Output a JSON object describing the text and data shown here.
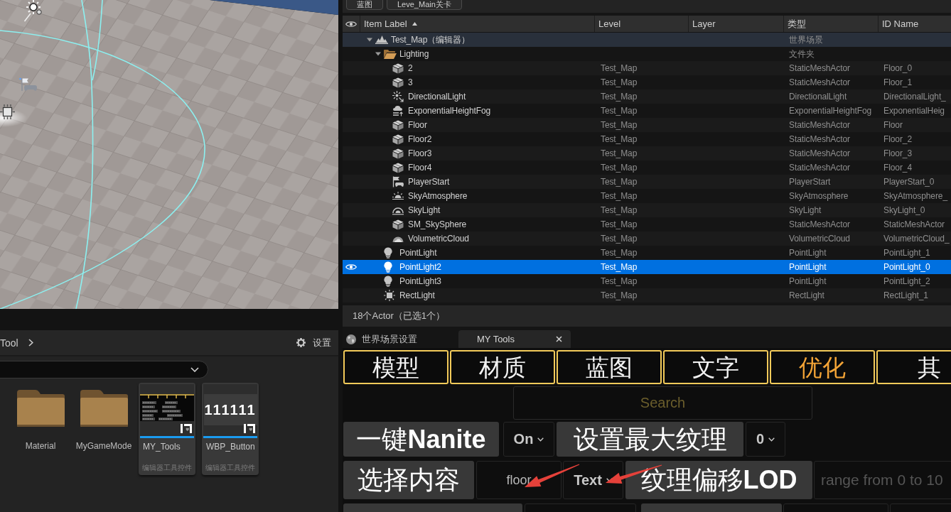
{
  "level_tabs": [
    {
      "label": "蓝图"
    },
    {
      "label": "Leve_Main关卡"
    }
  ],
  "outliner": {
    "columns": [
      {
        "label": "Item Label",
        "sorted": true
      },
      {
        "label": "Level",
        "sorted": false
      },
      {
        "label": "Layer",
        "sorted": false
      },
      {
        "label": "类型",
        "sorted": false
      },
      {
        "label": "ID Name",
        "sorted": false
      }
    ],
    "rows": [
      {
        "kind": "world",
        "label": "Test_Map（编辑器）",
        "type": "世界场景",
        "expanded": true,
        "selected": false,
        "children": [
          {
            "kind": "folder",
            "label": "Lighting",
            "type": "文件夹",
            "expanded": true,
            "selected": false,
            "children": [
              {
                "kind": "mesh",
                "label": "2",
                "level": "Test_Map",
                "type": "StaticMeshActor",
                "id_name": "Floor_0",
                "selected": false
              },
              {
                "kind": "mesh",
                "label": "3",
                "level": "Test_Map",
                "type": "StaticMeshActor",
                "id_name": "Floor_1",
                "selected": false
              },
              {
                "kind": "directional_light",
                "label": "DirectionalLight",
                "level": "Test_Map",
                "type": "DirectionalLight",
                "id_name": "DirectionalLight_",
                "selected": false
              },
              {
                "kind": "fog",
                "label": "ExponentialHeightFog",
                "level": "Test_Map",
                "type": "ExponentialHeightFog",
                "id_name": "ExponentialHeig",
                "selected": false
              },
              {
                "kind": "mesh",
                "label": "Floor",
                "level": "Test_Map",
                "type": "StaticMeshActor",
                "id_name": "Floor",
                "selected": false
              },
              {
                "kind": "mesh",
                "label": "Floor2",
                "level": "Test_Map",
                "type": "StaticMeshActor",
                "id_name": "Floor_2",
                "selected": false
              },
              {
                "kind": "mesh",
                "label": "Floor3",
                "level": "Test_Map",
                "type": "StaticMeshActor",
                "id_name": "Floor_3",
                "selected": false
              },
              {
                "kind": "mesh",
                "label": "Floor4",
                "level": "Test_Map",
                "type": "StaticMeshActor",
                "id_name": "Floor_4",
                "selected": false
              },
              {
                "kind": "player_start",
                "label": "PlayerStart",
                "level": "Test_Map",
                "type": "PlayerStart",
                "id_name": "PlayerStart_0",
                "selected": false
              },
              {
                "kind": "sky_atmosphere",
                "label": "SkyAtmosphere",
                "level": "Test_Map",
                "type": "SkyAtmosphere",
                "id_name": "SkyAtmosphere_",
                "selected": false
              },
              {
                "kind": "sky_light",
                "label": "SkyLight",
                "level": "Test_Map",
                "type": "SkyLight",
                "id_name": "SkyLight_0",
                "selected": false
              },
              {
                "kind": "mesh",
                "label": "SM_SkySphere",
                "level": "Test_Map",
                "type": "StaticMeshActor",
                "id_name": "StaticMeshActor",
                "selected": false
              },
              {
                "kind": "volumetric_cloud",
                "label": "VolumetricCloud",
                "level": "Test_Map",
                "type": "VolumetricCloud",
                "id_name": "VolumetricCloud_",
                "selected": false
              }
            ]
          },
          {
            "kind": "point_light",
            "label": "PointLight",
            "level": "Test_Map",
            "type": "PointLight",
            "id_name": "PointLight_1",
            "selected": false
          },
          {
            "kind": "point_light",
            "label": "PointLight2",
            "level": "Test_Map",
            "type": "PointLight",
            "id_name": "PointLight_0",
            "selected": true
          },
          {
            "kind": "point_light",
            "label": "PointLight3",
            "level": "Test_Map",
            "type": "PointLight",
            "id_name": "PointLight_2",
            "selected": false
          },
          {
            "kind": "rect_light",
            "label": "RectLight",
            "level": "Test_Map",
            "type": "RectLight",
            "id_name": "RectLight_1",
            "selected": false
          }
        ]
      }
    ],
    "footer": "18个Actor（已选1个）"
  },
  "content_browser": {
    "breadcrumb": "Tool",
    "settings_label": "设置",
    "assets": [
      {
        "kind": "folder",
        "name": "Material"
      },
      {
        "kind": "folder",
        "name": "MyGameMode"
      },
      {
        "kind": "widget",
        "name": "MY_Tools",
        "type": "编辑器工具控件",
        "thumbnail": {
          "kind": "panel"
        }
      },
      {
        "kind": "widget",
        "name": "WBP_Button",
        "type": "编辑器工具控件",
        "thumbnail": {
          "kind": "label",
          "text": "111111"
        }
      }
    ]
  },
  "panel_tabs": [
    {
      "label": "世界场景设置",
      "selected": false,
      "closable": false
    },
    {
      "label": "MY Tools",
      "selected": true,
      "closable": true
    }
  ],
  "tools": {
    "categories": [
      {
        "label": "模型",
        "selected": false
      },
      {
        "label": "材质",
        "selected": false
      },
      {
        "label": "蓝图",
        "selected": false
      },
      {
        "label": "文字",
        "selected": false
      },
      {
        "label": "优化",
        "selected": true
      },
      {
        "label": "其",
        "selected": false
      }
    ],
    "search": {
      "placeholder": "Search"
    },
    "rows": [
      [
        {
          "kind": "button",
          "label": "一键**Nanite**"
        },
        {
          "kind": "dropdown",
          "value": "On"
        },
        {
          "kind": "button",
          "label": "设置最大纹理"
        },
        {
          "kind": "dropdown",
          "value": "0"
        }
      ],
      [
        {
          "kind": "button",
          "label": "选择内容"
        },
        {
          "kind": "input",
          "value": "floor"
        },
        {
          "kind": "dropdown",
          "value": "Text"
        },
        {
          "kind": "button",
          "label": "纹理偏移**LOD**"
        },
        {
          "kind": "input",
          "placeholder": "range from 0 to 10"
        }
      ],
      [
        {
          "kind": "button"
        },
        {
          "kind": "input"
        },
        {
          "kind": "button"
        },
        {
          "kind": "input"
        },
        {
          "kind": "input"
        }
      ]
    ]
  }
}
